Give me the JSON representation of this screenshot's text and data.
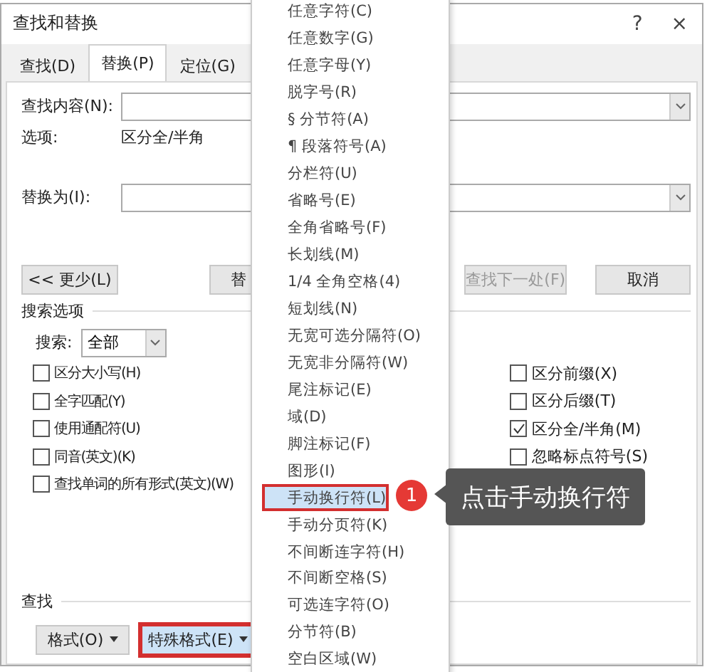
{
  "dialog": {
    "title": "查找和替换",
    "help": "?",
    "close": "×"
  },
  "tabs": [
    {
      "label": "查找(D)",
      "selected": false
    },
    {
      "label": "替换(P)",
      "selected": true
    },
    {
      "label": "定位(G)",
      "selected": false
    }
  ],
  "find": {
    "label": "查找内容(N):",
    "options_label": "选项:",
    "options_value": "区分全/半角"
  },
  "replace": {
    "label": "替换为(I):"
  },
  "buttons": [
    {
      "label": "<< 更少(L)",
      "disabled": false
    },
    {
      "label": "替",
      "disabled": false
    },
    {
      "label": "查找下一处(F)",
      "disabled": true
    },
    {
      "label": "取消",
      "disabled": false
    }
  ],
  "search_options": {
    "title": "搜索选项",
    "search_label": "搜索:",
    "search_value": "全部"
  },
  "left_options": [
    {
      "label": "区分大小写(H)",
      "checked": false
    },
    {
      "label": "全字匹配(Y)",
      "checked": false
    },
    {
      "label": "使用通配符(U)",
      "checked": false
    },
    {
      "label": "同音(英文)(K)",
      "checked": false
    },
    {
      "label": "查找单词的所有形式(英文)(W)",
      "checked": false
    }
  ],
  "right_options": [
    {
      "label": "区分前缀(X)",
      "checked": false
    },
    {
      "label": "区分后缀(T)",
      "checked": false
    },
    {
      "label": "区分全/半角(M)",
      "checked": true
    },
    {
      "label": "忽略标点符号(S)",
      "checked": false
    }
  ],
  "find_section": {
    "title": "查找",
    "buttons": [
      {
        "label": "格式(O)",
        "marked": false
      },
      {
        "label": "特殊格式(E)",
        "marked": true
      }
    ]
  },
  "menu": [
    {
      "label": "任意字符(C)",
      "selected": false,
      "marked": false
    },
    {
      "label": "任意数字(G)",
      "selected": false,
      "marked": false
    },
    {
      "label": "任意字母(Y)",
      "selected": false,
      "marked": false
    },
    {
      "label": "脱字号(R)",
      "selected": false,
      "marked": false
    },
    {
      "label": "§ 分节符(A)",
      "selected": false,
      "marked": false
    },
    {
      "label": "¶ 段落符号(A)",
      "selected": false,
      "marked": false
    },
    {
      "label": "分栏符(U)",
      "selected": false,
      "marked": false
    },
    {
      "label": "省略号(E)",
      "selected": false,
      "marked": false
    },
    {
      "label": "全角省略号(F)",
      "selected": false,
      "marked": false
    },
    {
      "label": "长划线(M)",
      "selected": false,
      "marked": false
    },
    {
      "label": "1/4 全角空格(4)",
      "selected": false,
      "marked": false
    },
    {
      "label": "短划线(N)",
      "selected": false,
      "marked": false
    },
    {
      "label": "无宽可选分隔符(O)",
      "selected": false,
      "marked": false
    },
    {
      "label": "无宽非分隔符(W)",
      "selected": false,
      "marked": false
    },
    {
      "label": "尾注标记(E)",
      "selected": false,
      "marked": false
    },
    {
      "label": "域(D)",
      "selected": false,
      "marked": false
    },
    {
      "label": "脚注标记(F)",
      "selected": false,
      "marked": false
    },
    {
      "label": "图形(I)",
      "selected": false,
      "marked": false
    },
    {
      "label": "手动换行符(L)",
      "selected": true,
      "marked": true
    },
    {
      "label": "手动分页符(K)",
      "selected": false,
      "marked": false
    },
    {
      "label": "不间断连字符(H)",
      "selected": false,
      "marked": false
    },
    {
      "label": "不间断空格(S)",
      "selected": false,
      "marked": false
    },
    {
      "label": "可选连字符(O)",
      "selected": false,
      "marked": false
    },
    {
      "label": "分节符(B)",
      "selected": false,
      "marked": false
    },
    {
      "label": "空白区域(W)",
      "selected": false,
      "marked": false
    }
  ],
  "callout": {
    "step": "1",
    "text": "点击手动换行符"
  }
}
